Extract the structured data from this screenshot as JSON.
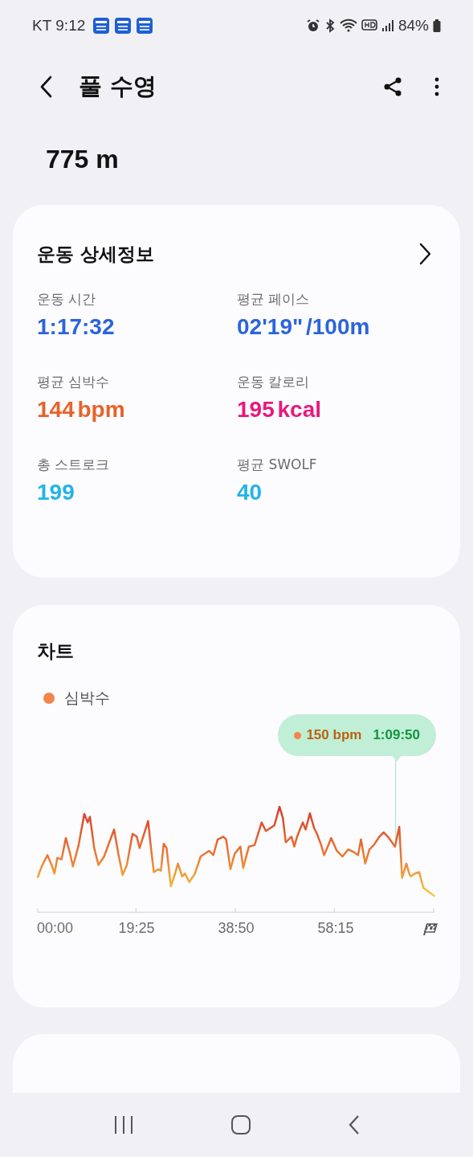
{
  "status_bar": {
    "carrier": "KT",
    "time": "9:12",
    "battery": "84%"
  },
  "header": {
    "title": "풀 수영"
  },
  "distance": "775 m",
  "details": {
    "title": "운동 상세정보",
    "stats": [
      {
        "label": "운동 시간",
        "value": "1:17:32",
        "color": "#2c64db"
      },
      {
        "label": "평균 페이스",
        "value": "02'19\" /100m",
        "color": "#2c64db"
      },
      {
        "label": "평균 심박수",
        "value": "144 bpm",
        "color": "#e8622a"
      },
      {
        "label": "운동 칼로리",
        "value": "195 kcal",
        "color": "#e8197c"
      },
      {
        "label": "총 스트로크",
        "value": "199",
        "color": "#22b4ea"
      },
      {
        "label": "평균 SWOLF",
        "value": "40",
        "color": "#22b4ea"
      }
    ]
  },
  "chart": {
    "title": "차트",
    "legend": [
      {
        "label": "심박수",
        "color": "#f5844c"
      }
    ],
    "tooltip": {
      "value": "150 bpm",
      "time": "1:09:50"
    },
    "x_labels": [
      "00:00",
      "19:25",
      "38:50",
      "58:15"
    ]
  }
}
